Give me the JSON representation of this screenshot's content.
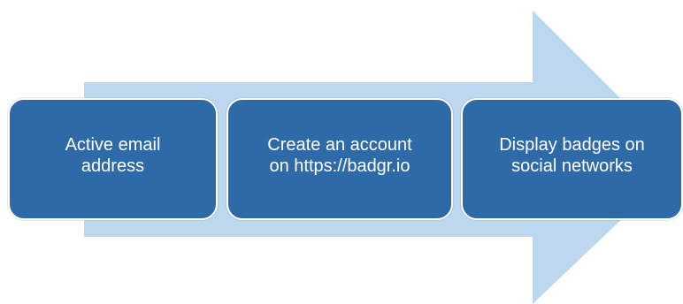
{
  "colors": {
    "arrow": "#bdd7ee",
    "box": "#2f6aa8",
    "box_border": "#ffffff",
    "text": "#ffffff"
  },
  "steps": [
    {
      "label": "Active email\naddress"
    },
    {
      "label": "Create an account\non https://badgr.io"
    },
    {
      "label": "Display badges on\nsocial networks"
    }
  ]
}
